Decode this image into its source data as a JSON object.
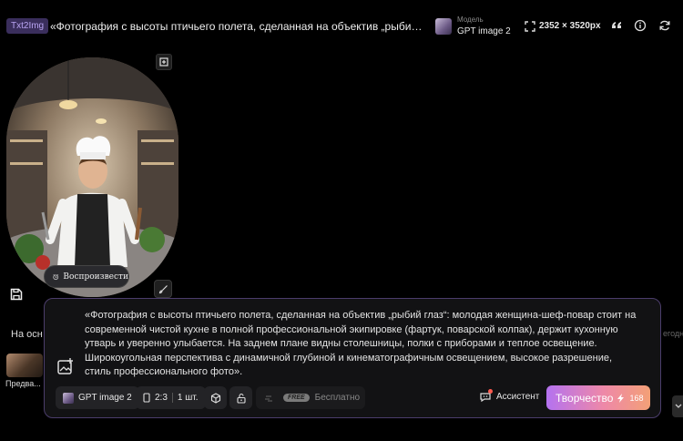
{
  "header": {
    "mode_tag": "Txt2Img",
    "prompt_title": "«Фотография с высоты птичьего полета, сделанная на объектив „рыбий глаз“:...",
    "model_label": "Модель",
    "model_name": "GPT image 2",
    "dimensions": "2352 × 3520px",
    "icons": [
      "fullscreen-icon",
      "quote-icon",
      "info-icon",
      "refresh-icon"
    ]
  },
  "image_card": {
    "replay_label": "Воспроизвести",
    "icons": [
      "expand-icon",
      "clock-icon",
      "brush-icon",
      "save-icon"
    ]
  },
  "left_panel": {
    "snippet": "На осн",
    "thumb_caption": "Предва..."
  },
  "right_panel": {
    "snippet": "егодн"
  },
  "prompt_panel": {
    "text": "«Фотография с высоты птичьего полета, сделанная на объектив „рыбий глаз“: молодая женщина-шеф-повар стоит на современной чистой кухне в полной профессиональной экипировке (фартук, поварской колпак), держит кухонную утварь и уверенно улыбается. На заднем плане видны столешницы, полки с приборами и теплое освещение. Широкоугольная перспектива с динамичной глубиной и кинематографичным освещением, высокое разрешение, стиль профессионального фото».",
    "model_chip": "GPT image 2",
    "ratio": "2:3",
    "count": "1 шт.",
    "free_badge": "FREE",
    "free_label": "Бесплатно",
    "assistant_label": "Ассистент",
    "create_label": "Творчество",
    "create_cost": "168",
    "behind_text": "...",
    "accent_color": "#4b3d6b"
  }
}
